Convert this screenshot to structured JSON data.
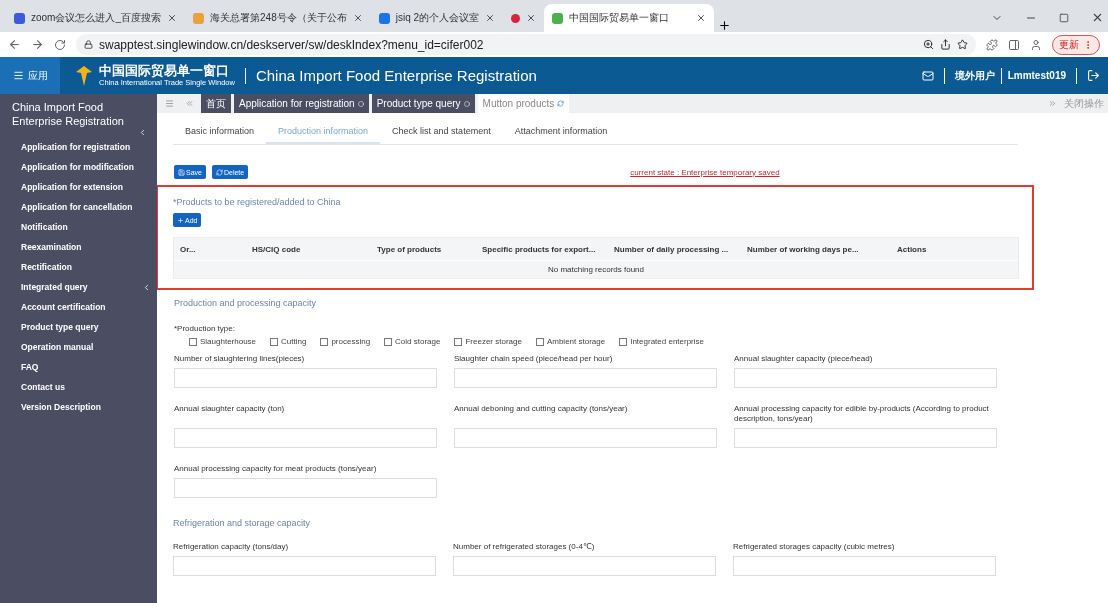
{
  "browser": {
    "tabs": [
      {
        "title": "zoom会议怎么进入_百度搜索",
        "selected": false,
        "recording": false
      },
      {
        "title": "海关总署第248号令（关于公布",
        "selected": false,
        "recording": false
      },
      {
        "title": "jsiq 2的个人会议室",
        "selected": false,
        "recording": false
      },
      {
        "selected": false,
        "recording": true
      },
      {
        "title": "中国国际贸易单一窗口",
        "selected": true,
        "recording": false
      }
    ],
    "url": "swapptest.singlewindow.cn/deskserver/sw/deskIndex?menu_id=cifer002",
    "update_button": "更新"
  },
  "header": {
    "apps_button": "应用",
    "logo_title": "中国国际贸易单一窗口",
    "logo_subtitle": "China International Trade Single Window",
    "title": "China Import Food Enterprise Registration",
    "user_type": "境外用户",
    "username": "Lmmtest019"
  },
  "sidebar": {
    "title": "China Import Food Enterprise Registration",
    "items": [
      {
        "label": "Application for registration"
      },
      {
        "label": "Application for modification"
      },
      {
        "label": "Application for extension"
      },
      {
        "label": "Application for cancellation"
      },
      {
        "label": "Notification"
      },
      {
        "label": "Reexamination"
      },
      {
        "label": "Rectification"
      },
      {
        "label": "Integrated query",
        "expanded": false
      },
      {
        "label": "Account certification"
      },
      {
        "label": "Product type query"
      },
      {
        "label": "Operation manual"
      },
      {
        "label": "FAQ"
      },
      {
        "label": "Contact us"
      },
      {
        "label": "Version Description"
      }
    ]
  },
  "page_tabs": {
    "tabs": [
      {
        "label": "首页",
        "selected": false
      },
      {
        "label": "Application for registration",
        "selected": false
      },
      {
        "label": "Product type query",
        "selected": false
      },
      {
        "label": "Mutton products",
        "selected": true
      }
    ],
    "close_menu": "关闭操作"
  },
  "form_tabs": [
    {
      "label": "Basic information",
      "selected": false
    },
    {
      "label": "Production information",
      "selected": true
    },
    {
      "label": "Check list and statement",
      "selected": false
    },
    {
      "label": "Attachment information",
      "selected": false
    }
  ],
  "actions": [
    "Save",
    "Delete"
  ],
  "status": "current state : Enterprise temporary saved",
  "products": {
    "title": "*Products to be registered/added to China",
    "add_button": "Add",
    "columns": [
      "Or...",
      "HS/CIQ code",
      "Type of products",
      "Specific products for export...",
      "Number of daily processing ...",
      "Number of working days pe...",
      "Actions"
    ],
    "empty_text": "No matching records found"
  },
  "capacity": {
    "title": "Production and processing capacity",
    "production_type_label": "*Production type:",
    "production_types": [
      {
        "label": "Slaughterhouse",
        "checked": false
      },
      {
        "label": "Cutting",
        "checked": false
      },
      {
        "label": "processing",
        "checked": false
      },
      {
        "label": "Cold storage",
        "checked": false
      },
      {
        "label": "Freezer storage",
        "checked": false
      },
      {
        "label": "Ambient storage",
        "checked": false
      },
      {
        "label": "Integrated enterprise",
        "checked": false
      }
    ],
    "fields": [
      {
        "label": "Number of slaughtering lines(pieces)"
      },
      {
        "label": "Slaughter chain speed (piece/head per hour)"
      },
      {
        "label": "Annual slaughter capacity (piece/head)"
      },
      {
        "label": "Annual slaughter capacity (ton)"
      },
      {
        "label": "Annual deboning and cutting capacity (tons/year)"
      },
      {
        "label": "Annual processing capacity for edible by-products (According to product description, tons/year)"
      },
      {
        "label": "Annual processing capacity for meat products (tons/year)"
      }
    ]
  },
  "refrigeration": {
    "title": "Refrigeration and storage capacity",
    "fields": [
      {
        "label": "Refrigeration capacity (tons/day)"
      },
      {
        "label": "Number of refrigerated storages (0-4℃)"
      },
      {
        "label": "Refrigerated storages capacity (cubic metres)"
      }
    ]
  }
}
